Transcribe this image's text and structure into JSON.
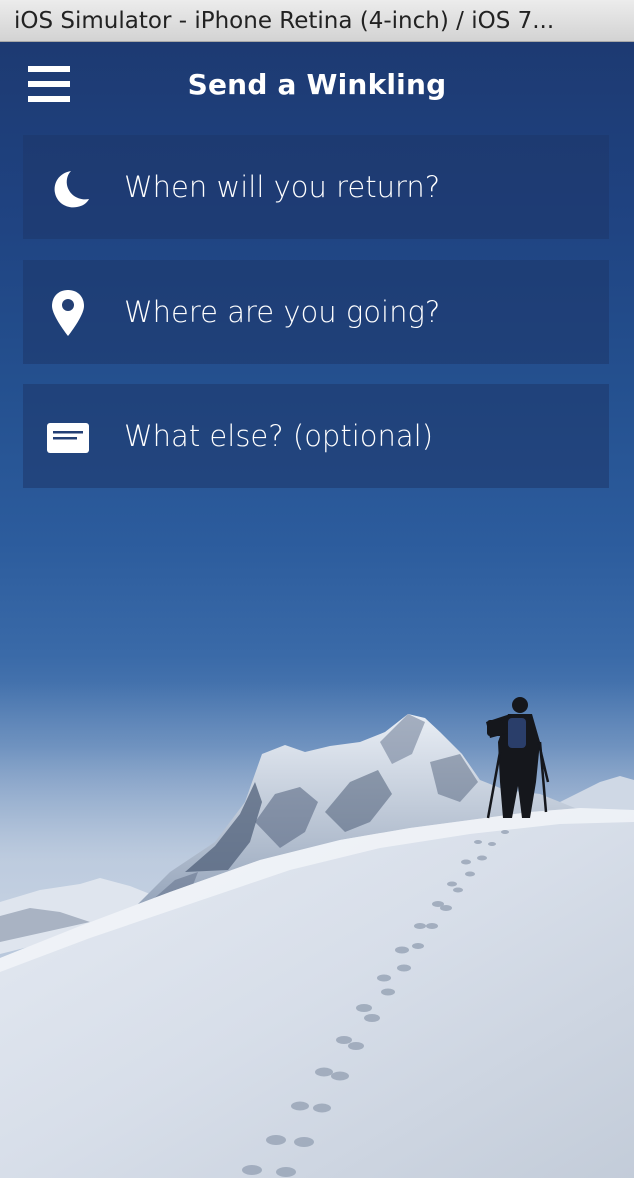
{
  "window": {
    "title": "iOS Simulator - iPhone Retina (4-inch) / iOS 7..."
  },
  "navbar": {
    "title": "Send a Winkling",
    "menu_icon": "hamburger-menu-icon"
  },
  "form": {
    "rows": [
      {
        "icon": "moon-icon",
        "label": "When will you return?"
      },
      {
        "icon": "map-pin-icon",
        "label": "Where are you going?"
      },
      {
        "icon": "note-icon",
        "label": "What else? (optional)"
      }
    ]
  },
  "colors": {
    "sky_top": "#1d3a72",
    "row_background": "rgba(30,55,105,0.55)",
    "text": "#ffffff"
  }
}
